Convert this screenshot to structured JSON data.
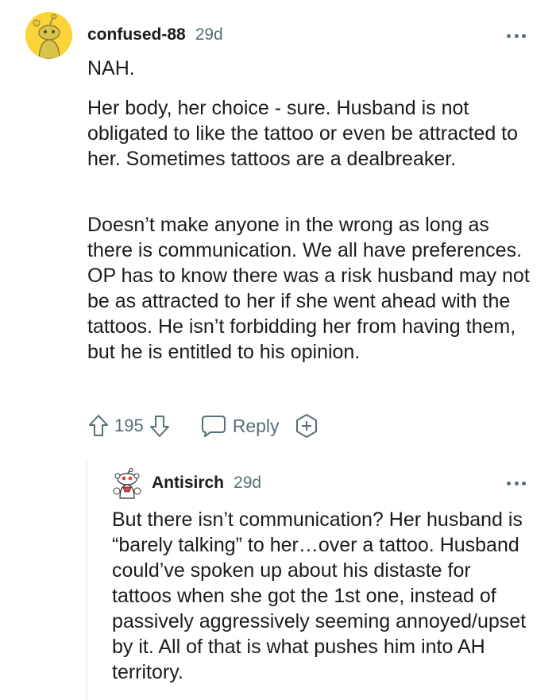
{
  "comment": {
    "author": "confused-88",
    "age": "29d",
    "paragraphs": [
      "NAH.",
      "Her body, her choice - sure. Husband is not obligated to like the tattoo or even be attracted to her. Sometimes tattoos are a dealbreaker.",
      "Doesn’t make anyone in the wrong as long as there is communication. We all have preferences. OP has to know there was a risk husband may not be as attracted to her if she went ahead with the tattoos. He isn’t forbidding her from having them, but he is entitled to his opinion."
    ],
    "score": "195",
    "reply_label": "Reply",
    "avatar_color": "#fcd43a"
  },
  "reply": {
    "author": "Antisirch",
    "age": "29d",
    "text": "But there isn’t communication? Her husband is “barely talking” to her…over a tattoo. Husband could’ve spoken up about his distaste for tattoos when she got the 1st one, instead of passively aggressively seeming annoyed/upset by it. All of that is what pushes him into AH territory."
  },
  "icons": {
    "more": "more-options-icon",
    "upvote": "upvote-arrow-icon",
    "downvote": "downvote-arrow-icon",
    "reply": "speech-bubble-icon",
    "award": "add-award-icon"
  },
  "colors": {
    "text": "#1c1c1c",
    "meta": "#576f76",
    "thread_line": "#edeff1"
  }
}
